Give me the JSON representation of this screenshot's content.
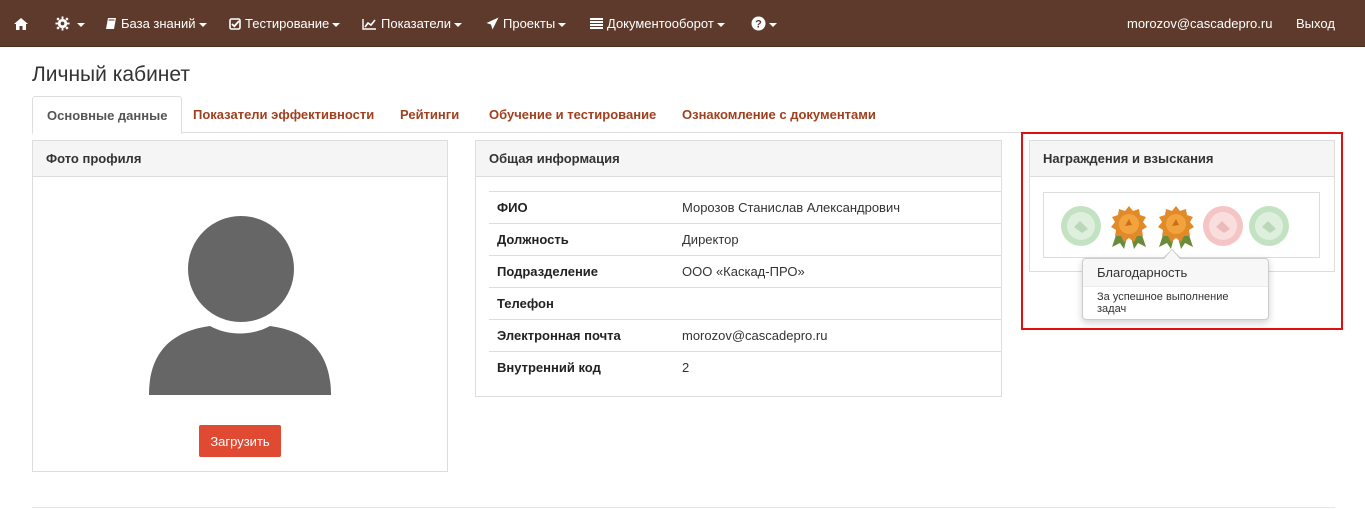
{
  "navbar": {
    "home_icon": "home-icon",
    "settings_icon": "gear-icon",
    "knowledge_label": "База знаний",
    "testing_label": "Тестирование",
    "metrics_label": "Показатели",
    "projects_label": "Проекты",
    "docs_label": "Документооборот",
    "help_icon": "question-circle-icon",
    "user_email": "morozov@cascadepro.ru",
    "logout_label": "Выход",
    "bg_color": "#5d3a2b"
  },
  "page": {
    "title": "Личный кабинет"
  },
  "tabs": [
    {
      "label": "Основные данные",
      "active": true
    },
    {
      "label": "Показатели эффективности",
      "active": false
    },
    {
      "label": "Рейтинги",
      "active": false
    },
    {
      "label": "Обучение и тестирование",
      "active": false
    },
    {
      "label": "Ознакомление с документами",
      "active": false
    }
  ],
  "photo_panel": {
    "heading": "Фото профиля",
    "upload_label": "Загрузить",
    "upload_color": "#e04a32"
  },
  "info_panel": {
    "heading": "Общая информация",
    "rows": [
      {
        "label": "ФИО",
        "value": "Морозов Станислав Александрович"
      },
      {
        "label": "Должность",
        "value": "Директор"
      },
      {
        "label": "Подразделение",
        "value": "ООО «Каскад-ПРО»"
      },
      {
        "label": "Телефон",
        "value": ""
      },
      {
        "label": "Электронная почта",
        "value": "morozov@cascadepro.ru"
      },
      {
        "label": "Внутренний код",
        "value": "2"
      }
    ]
  },
  "awards_panel": {
    "heading": "Награждения и взыскания",
    "medals": [
      {
        "kind": "green-faded"
      },
      {
        "kind": "gold"
      },
      {
        "kind": "gold"
      },
      {
        "kind": "red-faded"
      },
      {
        "kind": "green-faded"
      }
    ],
    "popover": {
      "title": "Благодарность",
      "content": "За успешное выполнение задач"
    }
  }
}
